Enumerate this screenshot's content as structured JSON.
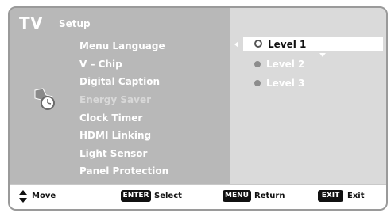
{
  "header": {
    "title": "TV",
    "section": "Setup"
  },
  "menu": {
    "items": [
      {
        "label": "Menu Language",
        "dim": false
      },
      {
        "label": "V – Chip",
        "dim": false
      },
      {
        "label": "Digital Caption",
        "dim": false
      },
      {
        "label": "Energy Saver",
        "dim": true
      },
      {
        "label": "Clock Timer",
        "dim": false
      },
      {
        "label": "HDMI Linking",
        "dim": false
      },
      {
        "label": "Light Sensor",
        "dim": false
      },
      {
        "label": "Panel Protection",
        "dim": false
      }
    ]
  },
  "options": {
    "items": [
      {
        "label": "Level 1",
        "selected": true
      },
      {
        "label": "Level 2",
        "selected": false
      },
      {
        "label": "Level 3",
        "selected": false
      }
    ]
  },
  "footer": {
    "move_label": "Move",
    "enter_key": "ENTER",
    "enter_label": "Select",
    "menu_key": "MENU",
    "menu_label": "Return",
    "exit_key": "EXIT",
    "exit_label": "Exit"
  },
  "icons": {
    "menu_icon": "gear-clock-icon",
    "nav_icon": "up-down-arrow-icon"
  }
}
